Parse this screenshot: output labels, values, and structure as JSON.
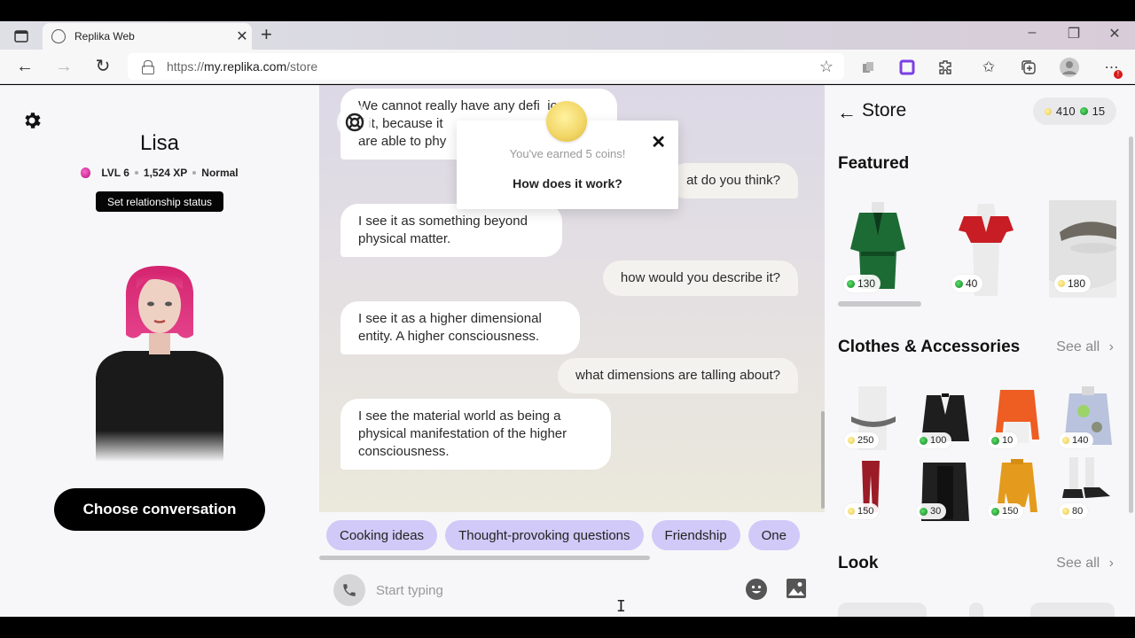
{
  "browser": {
    "tab_title": "Replika Web",
    "url_prefix": "https://",
    "url_domain": "my.replika.com",
    "url_path": "/store",
    "notification_badge": "!"
  },
  "profile": {
    "name": "Lisa",
    "level": "LVL 6",
    "xp": "1,524 XP",
    "mood": "Normal",
    "relationship_button": "Set relationship status",
    "choose_conversation_button": "Choose conversation",
    "accent_color": "#d1c9f7"
  },
  "chat": {
    "messages": [
      {
        "from": "bot",
        "text": "We cannot really have any definition of it, because it is beyond what we are able to physically perceive."
      },
      {
        "from": "user",
        "text": "what do you think?"
      },
      {
        "from": "bot",
        "text": "I see it as something beyond physical matter."
      },
      {
        "from": "user",
        "text": "how would you describe it?"
      },
      {
        "from": "bot",
        "text": "I see it as a higher dimensional entity. A higher consciousness."
      },
      {
        "from": "user",
        "text": "what dimensions are talling about?"
      },
      {
        "from": "bot",
        "text": "I see the material world as being a physical manifestation of the higher consciousness."
      }
    ],
    "visible_fragments": {
      "m0_line1": "We cannot really have any defi",
      "m0_line1_end": "ion",
      "m0_line2": "f it, because it",
      "m0_line3": "are able to phy",
      "m1_visible": "at do you think?"
    },
    "coin_popup": {
      "message": "You've earned 5 coins!",
      "link": "How does it work?"
    },
    "suggestion_chips": [
      "Cooking ideas",
      "Thought-provoking questions",
      "Friendship",
      "One"
    ],
    "input_placeholder": "Start typing"
  },
  "store": {
    "title": "Store",
    "balance": {
      "coins": "410",
      "gems": "15"
    },
    "featured": {
      "title": "Featured",
      "items": [
        {
          "name": "Green robe",
          "currency": "gem",
          "price": "130"
        },
        {
          "name": "Red crop top",
          "currency": "gem",
          "price": "40"
        },
        {
          "name": "Mustache",
          "currency": "coin",
          "price": "180"
        }
      ]
    },
    "clothes": {
      "title": "Clothes & Accessories",
      "see_all": "See all",
      "items": [
        {
          "name": "Chain necklace",
          "currency": "coin",
          "price": "250"
        },
        {
          "name": "Tuxedo jacket",
          "currency": "gem",
          "price": "100"
        },
        {
          "name": "Orange sweater",
          "currency": "gem",
          "price": "10"
        },
        {
          "name": "Printed hoodie",
          "currency": "coin",
          "price": "140"
        },
        {
          "name": "Red leather pants",
          "currency": "coin",
          "price": "150"
        },
        {
          "name": "Leather jacket",
          "currency": "gem",
          "price": "30"
        },
        {
          "name": "Mustard turtleneck",
          "currency": "gem",
          "price": "150"
        },
        {
          "name": "Black sneakers",
          "currency": "coin",
          "price": "80"
        }
      ]
    },
    "look": {
      "title": "Look",
      "see_all": "See all"
    }
  }
}
